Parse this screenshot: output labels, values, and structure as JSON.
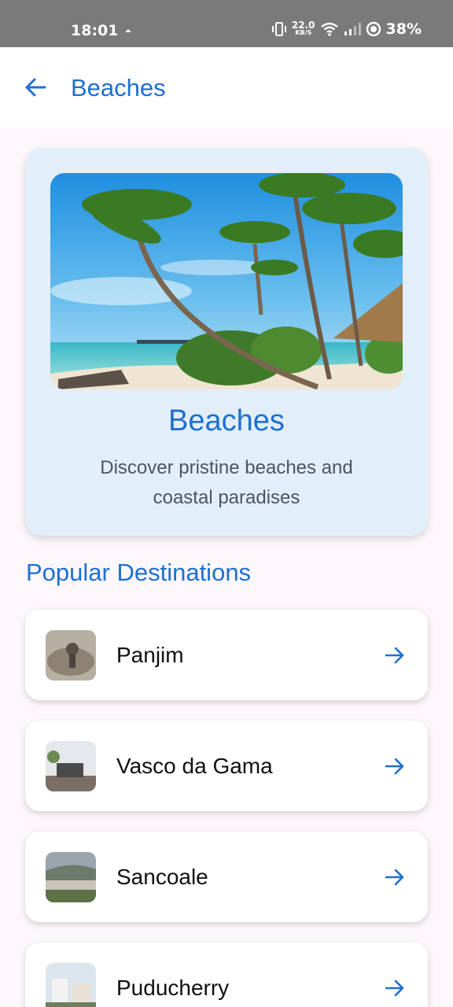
{
  "status_bar": {
    "time": "18:01",
    "net_speed_value": "22.0",
    "net_speed_unit": "KB/S",
    "battery": "38%"
  },
  "app_bar": {
    "title": "Beaches",
    "back_icon": "arrow-left-icon"
  },
  "hero": {
    "title": "Beaches",
    "description": "Discover pristine beaches and coastal paradises",
    "image": "tropical-beach-palms-image"
  },
  "section": {
    "title": "Popular Destinations"
  },
  "destinations": [
    {
      "name": "Panjim",
      "thumb": "panjim-thumbnail"
    },
    {
      "name": "Vasco da Gama",
      "thumb": "vasco-da-gama-thumbnail"
    },
    {
      "name": "Sancoale",
      "thumb": "sancoale-thumbnail"
    },
    {
      "name": "Puducherry",
      "thumb": "puducherry-thumbnail"
    }
  ],
  "colors": {
    "accent": "#1f6fd1",
    "hero_bg": "#e2eef9",
    "page_bg": "#fbf7fb"
  }
}
